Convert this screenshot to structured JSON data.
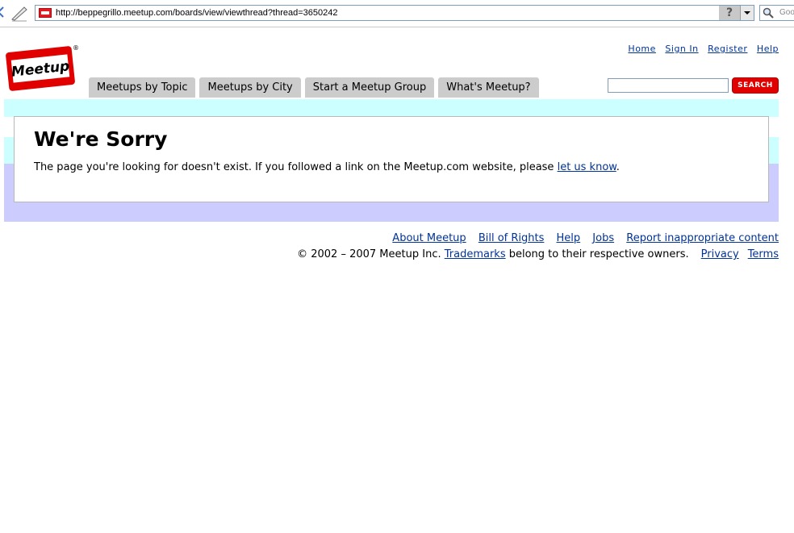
{
  "browser": {
    "url": "http://beppegrillo.meetup.com/boards/view/viewthread?thread=3650242",
    "help_glyph": "?",
    "search_engine_text": "Goo",
    "icons": [
      "back-arrow-icon",
      "edit-pencil-icon",
      "meetup-favicon",
      "dropdown-arrow-icon",
      "magnifier-icon"
    ]
  },
  "header": {
    "logo_text": "Meetup",
    "registered_mark": "®",
    "top_links": [
      "Home",
      "Sign In",
      "Register",
      "Help"
    ],
    "tabs": [
      "Meetups by Topic",
      "Meetups by City",
      "Start a Meetup Group",
      "What's Meetup?"
    ],
    "search": {
      "value": "",
      "button_label": "SEARCH"
    }
  },
  "content": {
    "heading": "We're Sorry",
    "message_before": "The page you're looking for doesn't exist. If you followed a link on the Meetup.com website, please ",
    "message_link": "let us know",
    "message_after": "."
  },
  "footer": {
    "links": [
      "About Meetup",
      "Bill of Rights",
      "Help",
      "Jobs",
      "Report inappropriate content"
    ],
    "copyright_before": "© 2002 – 2007 Meetup Inc. ",
    "trademarks_link": "Trademarks",
    "copyright_after": " belong to their respective owners.",
    "legal_links": [
      "Privacy",
      "Terms"
    ]
  },
  "colors": {
    "brand_red": "#e00000",
    "link": "#003399",
    "band_cyan": "#ccffff",
    "band_lavender": "#ccccff",
    "tab_gray": "#cccccc"
  }
}
